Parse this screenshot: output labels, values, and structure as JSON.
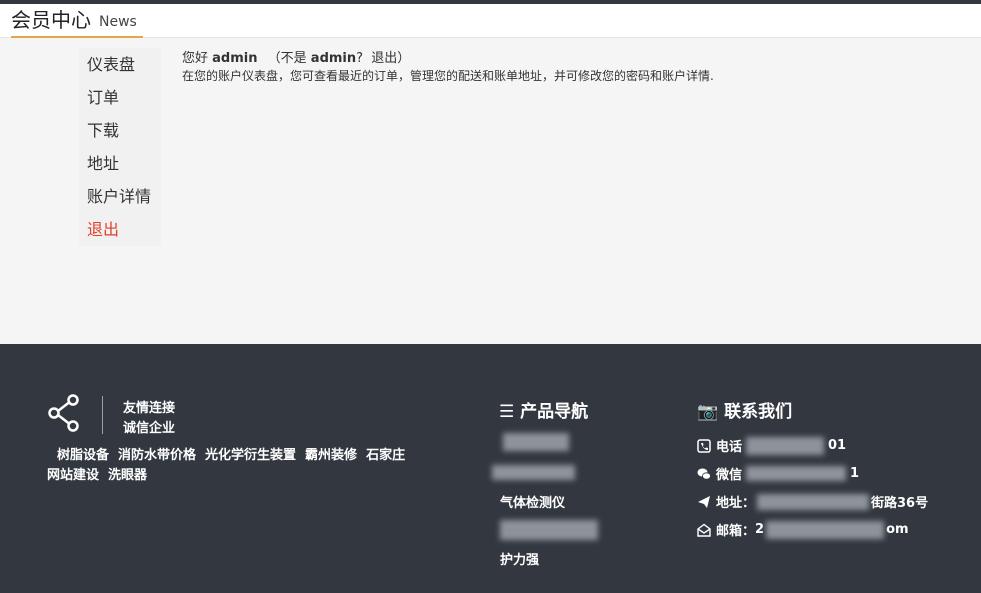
{
  "header": {
    "title": "会员中心",
    "subtitle": "News"
  },
  "sidebar": {
    "items": [
      {
        "label": "仪表盘"
      },
      {
        "label": "订单"
      },
      {
        "label": "下载"
      },
      {
        "label": "地址"
      },
      {
        "label": "账户详情"
      },
      {
        "label": "退出"
      }
    ]
  },
  "greeting": {
    "hello": "您好",
    "user": "admin",
    "not_prefix": "（不是",
    "not_user": "admin",
    "question": "?",
    "logout": "退出",
    "close_paren": "）",
    "description": "在您的账户仪表盘，您可查看最近的订单，管理您的配送和账单地址，并可修改您的密码和账户详情."
  },
  "footer": {
    "friend_title": "友情连接",
    "friend_sub": "诚信企业",
    "links": [
      "树脂设备",
      "消防水带价格",
      "光化学衍生装置",
      "霸州装修",
      "石家庄",
      "网站建设",
      "洗眼器"
    ],
    "products_title": "产品导航",
    "products": [
      "气体检测仪",
      "护力强"
    ],
    "contact_title": "联系我们",
    "contact": {
      "phone_label": "电话",
      "phone_suffix": "01",
      "wechat_label": "微信",
      "wechat_suffix": "1",
      "address_label": "地址：",
      "address_suffix": "街路36号",
      "email_label": "邮箱：",
      "email_prefix": "2",
      "email_suffix": "om"
    }
  },
  "colors": {
    "accent": "#e0a84a",
    "active": "#e0402e",
    "footer_bg": "#333840"
  }
}
